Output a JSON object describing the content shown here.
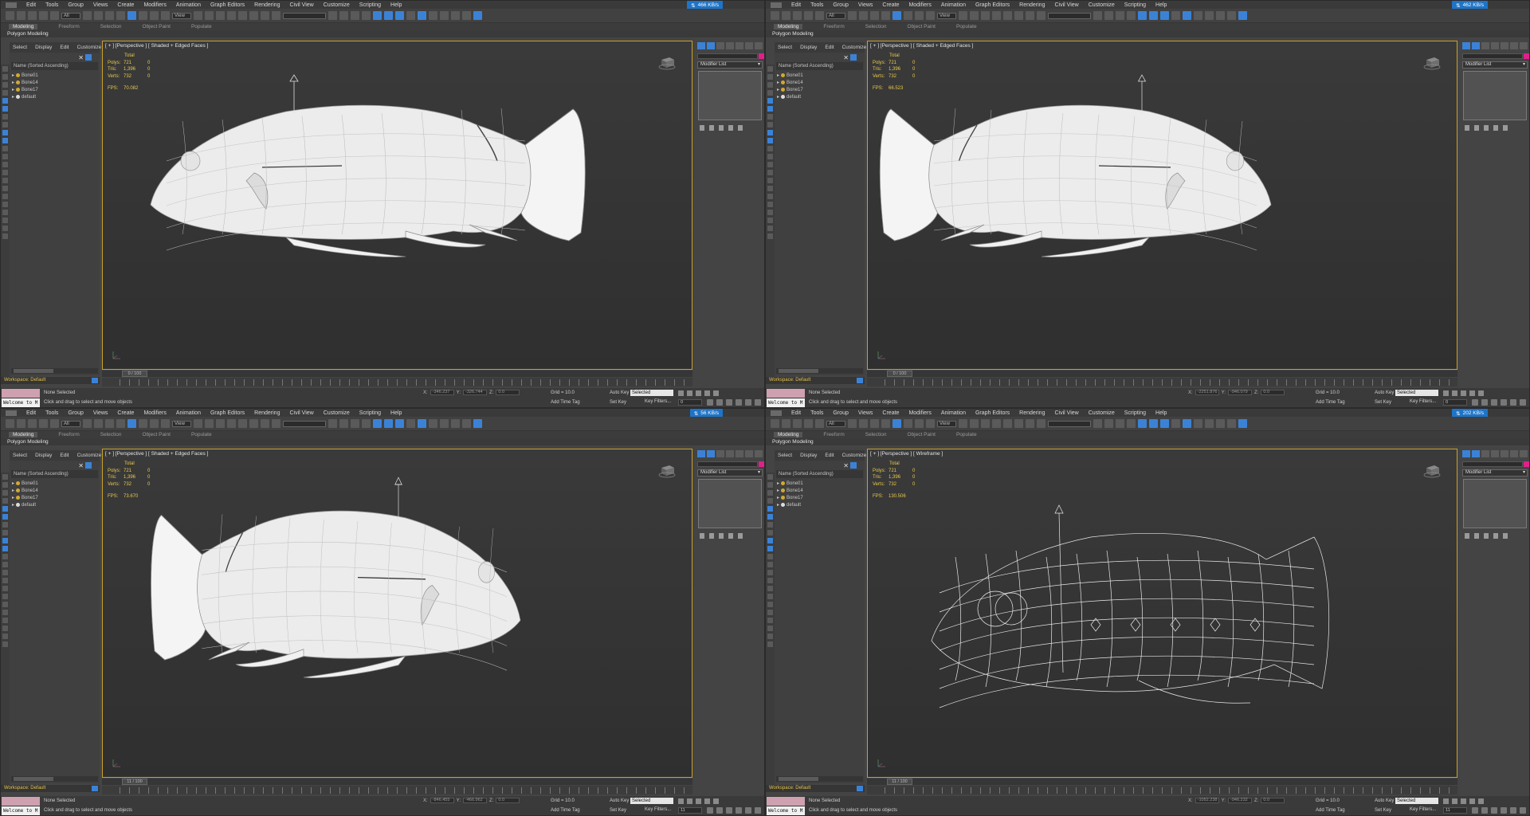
{
  "menu": [
    "Edit",
    "Tools",
    "Group",
    "Views",
    "Create",
    "Modifiers",
    "Animation",
    "Graph Editors",
    "Rendering",
    "Civil View",
    "Customize",
    "Scripting",
    "Help"
  ],
  "ribbon_tabs": [
    "Modeling",
    "Freeform",
    "Selection",
    "Object Paint",
    "Populate"
  ],
  "subribbon": "Polygon Modeling",
  "toolbar": {
    "filter": "All",
    "refcoord": "View"
  },
  "explorer": {
    "tabs": [
      "Select",
      "Display",
      "Edit",
      "Customize"
    ],
    "header": "Name (Sorted Ascending)",
    "items": [
      "Bone01",
      "Bone14",
      "Bone17",
      "default"
    ]
  },
  "stats_labels": {
    "total": "Total",
    "polys": "Polys:",
    "tris": "Tris:",
    "verts": "Verts:",
    "fps": "FPS:"
  },
  "command_panel": {
    "modifier_list": "Modifier List"
  },
  "status": {
    "none_selected": "None Selected",
    "welcome": "Welcome to M",
    "prompt": "Click and drag to select and move objects",
    "grid": "Grid = 10.0",
    "add_time_tag": "Add Time Tag",
    "auto_key": "Auto Key",
    "set_key": "Set Key",
    "selected": "Selected",
    "key_filters": "Key Filters...",
    "x_label": "X:",
    "y_label": "Y:",
    "z_label": "Z:"
  },
  "workspace": "Workspace: Default",
  "colors": {
    "accent_blue": "#3b82d6",
    "viewport_border": "#c9a227",
    "stats_yellow": "#e8c94a",
    "mesh_white": "#efefef"
  },
  "windows": [
    {
      "net_speed": "466 KB/s",
      "viewport_label": "[ + ] [Perspective ] [ Shaded + Edged Faces ]",
      "stats": {
        "polys": "721",
        "tris": "1,396",
        "verts": "732",
        "fps": "70.082",
        "zero": "0"
      },
      "frame": "0 / 100",
      "frame_field": "0",
      "coord_x": "-346.237",
      "coord_y": "-326.744",
      "coord_z": "0.0",
      "view": "side-left"
    },
    {
      "net_speed": "462 KB/s",
      "viewport_label": "[ + ] [Perspective ] [ Shaded + Edged Faces ]",
      "stats": {
        "polys": "721",
        "tris": "1,396",
        "verts": "732",
        "fps": "66.523",
        "zero": "0"
      },
      "frame": "0 / 100",
      "frame_field": "0",
      "coord_x": "-2251.876",
      "coord_y": "-946.079",
      "coord_z": "0.0",
      "view": "three-quarter-rear"
    },
    {
      "net_speed": "56 KB/s",
      "viewport_label": "[ + ] [Perspective ] [ Shaded + Edged Faces ]",
      "stats": {
        "polys": "721",
        "tris": "1,396",
        "verts": "732",
        "fps": "73.670",
        "zero": "0"
      },
      "frame": "11 / 100",
      "frame_field": "11",
      "coord_x": "-846.455",
      "coord_y": "-466.962",
      "coord_z": "0.0",
      "view": "three-quarter-front-right"
    },
    {
      "net_speed": "202 KB/s",
      "viewport_label": "[ + ] [Perspective ] [ Wireframe ]",
      "stats": {
        "polys": "721",
        "tris": "1,396",
        "verts": "732",
        "fps": "130.506",
        "zero": "0"
      },
      "frame": "11 / 100",
      "frame_field": "11",
      "coord_x": "-1052.238",
      "coord_y": "-946.232",
      "coord_z": "0.0",
      "view": "wireframe-side"
    }
  ]
}
